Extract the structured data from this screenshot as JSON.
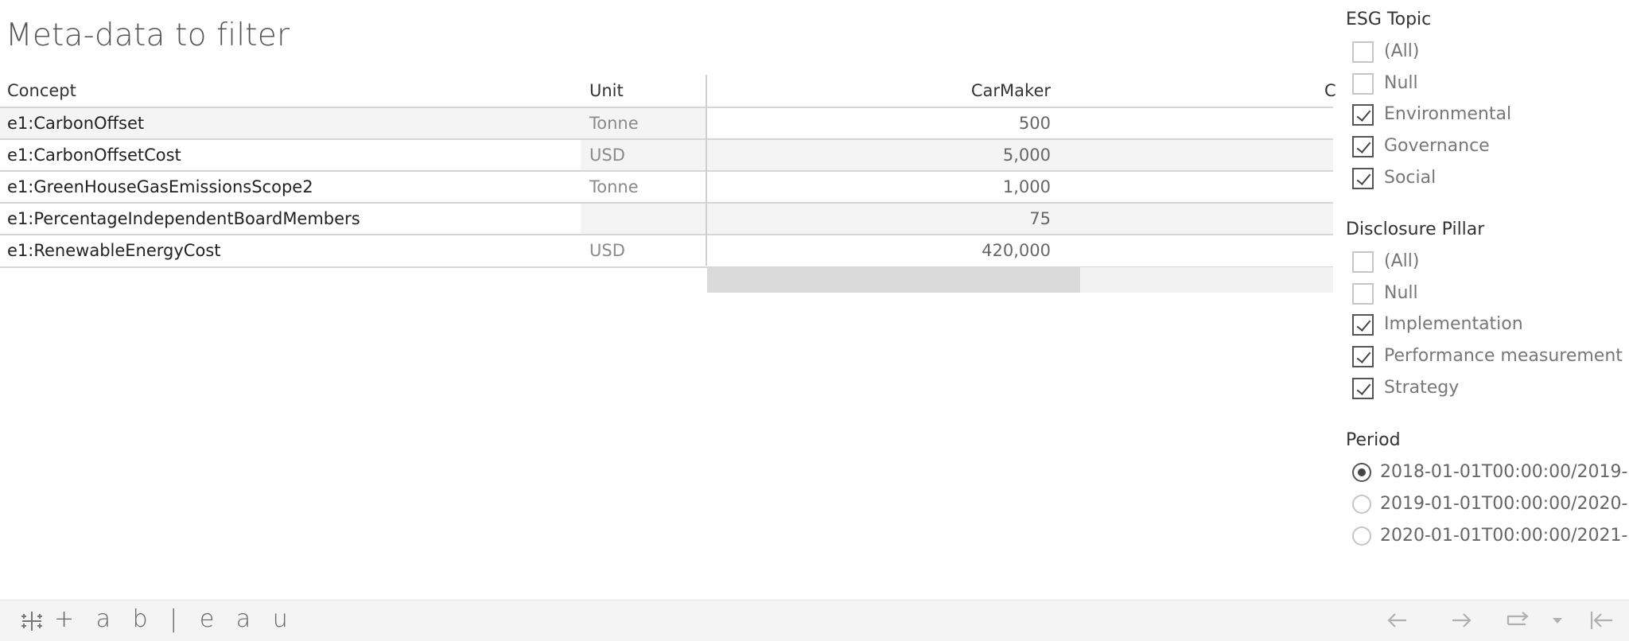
{
  "title": "Meta-data to filter",
  "table": {
    "headers": {
      "concept": "Concept",
      "unit": "Unit",
      "company": "CarMaker",
      "next_company_partial": "C"
    },
    "rows": [
      {
        "concept": "e1:CarbonOffset",
        "unit": "Tonne",
        "value": "500"
      },
      {
        "concept": "e1:CarbonOffsetCost",
        "unit": "USD",
        "value": "5,000"
      },
      {
        "concept": "e1:GreenHouseGasEmissionsScope2",
        "unit": "Tonne",
        "value": "1,000"
      },
      {
        "concept": "e1:PercentageIndependentBoardMembers",
        "unit": "",
        "value": "75"
      },
      {
        "concept": "e1:RenewableEnergyCost",
        "unit": "USD",
        "value": "420,000"
      }
    ]
  },
  "filters": {
    "esg_topic": {
      "title": "ESG Topic",
      "options": [
        {
          "label": "(All)",
          "checked": false
        },
        {
          "label": "Null",
          "checked": false
        },
        {
          "label": "Environmental",
          "checked": true
        },
        {
          "label": "Governance",
          "checked": true
        },
        {
          "label": "Social",
          "checked": true
        }
      ]
    },
    "disclosure_pillar": {
      "title": "Disclosure Pillar",
      "options": [
        {
          "label": "(All)",
          "checked": false
        },
        {
          "label": "Null",
          "checked": false
        },
        {
          "label": "Implementation",
          "checked": true
        },
        {
          "label": "Performance measurement",
          "checked": true
        },
        {
          "label": "Strategy",
          "checked": true
        }
      ]
    },
    "period": {
      "title": "Period",
      "options": [
        {
          "label": "2018-01-01T00:00:00/2019-",
          "selected": true
        },
        {
          "label": "2019-01-01T00:00:00/2020-",
          "selected": false
        },
        {
          "label": "2020-01-01T00:00:00/2021-",
          "selected": false
        }
      ]
    }
  },
  "footer": {
    "logo_text": "+ a b | e a u",
    "icons": [
      "back-arrow-icon",
      "forward-arrow-icon",
      "revert-icon",
      "dropdown-caret-icon",
      "reset-icon"
    ]
  }
}
